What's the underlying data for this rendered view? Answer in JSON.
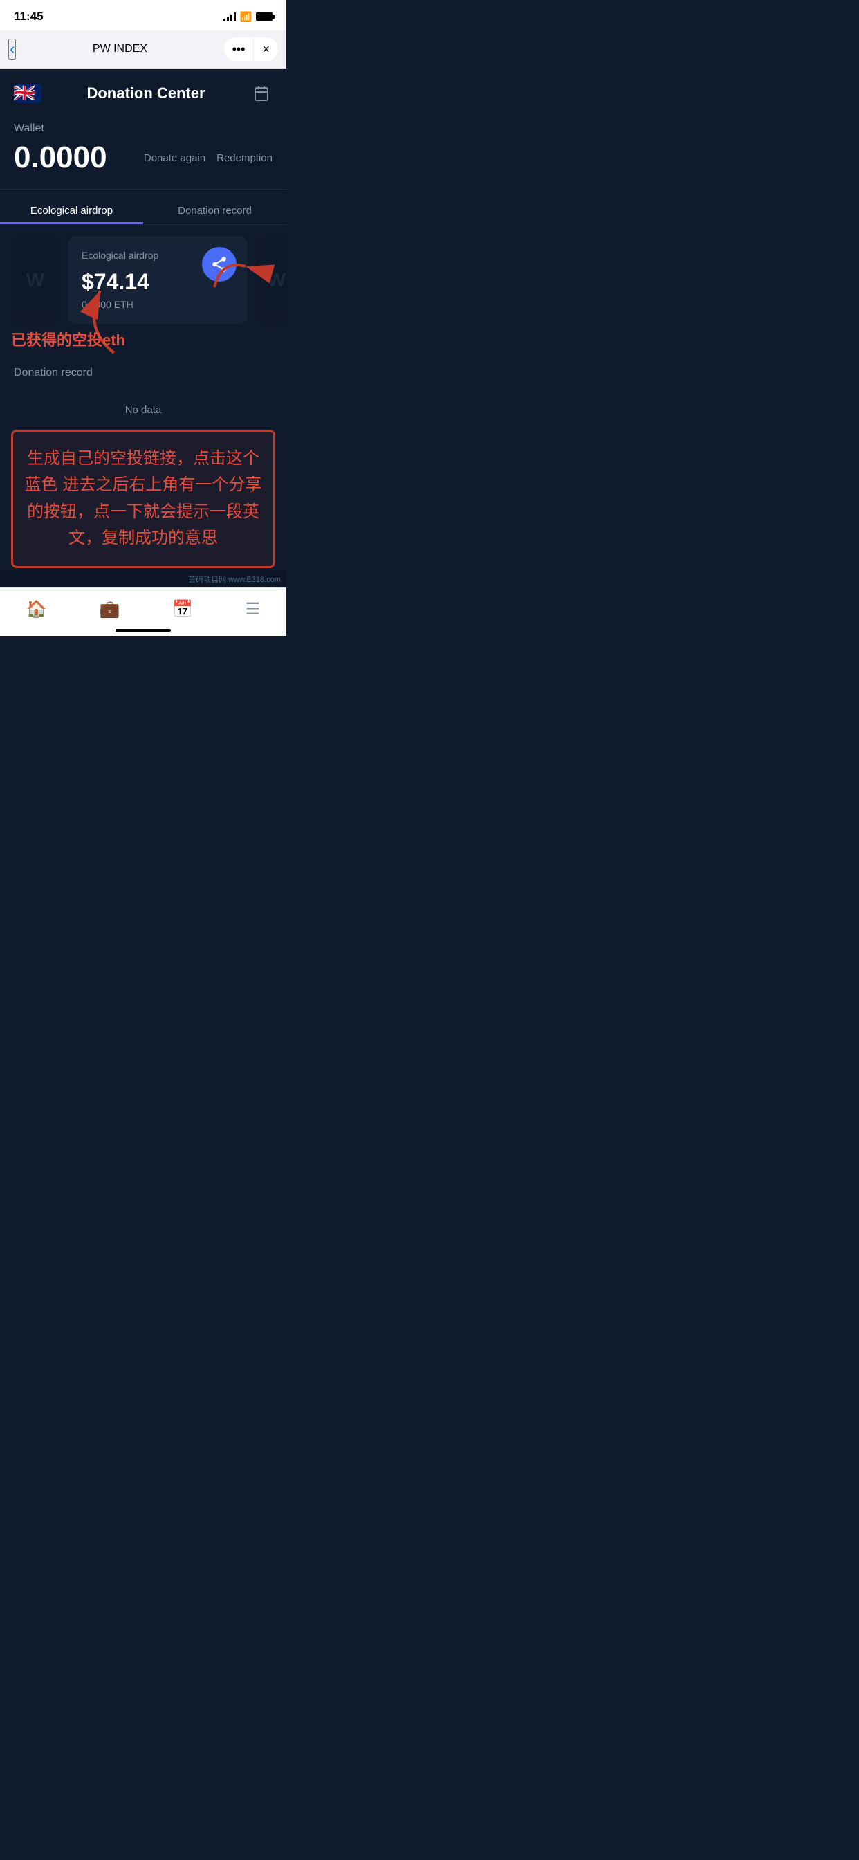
{
  "statusBar": {
    "time": "11:45",
    "batteryFull": true
  },
  "browserBar": {
    "title": "PW INDEX",
    "backLabel": "<",
    "moreLabel": "•••",
    "closeLabel": "×"
  },
  "appHeader": {
    "title": "Donation Center",
    "calendarIcon": "📅"
  },
  "wallet": {
    "label": "Wallet",
    "amount": "0.0000",
    "donateAgainLabel": "Donate again",
    "redemptionLabel": "Redemption"
  },
  "tabs": [
    {
      "label": "Ecological airdrop",
      "active": true
    },
    {
      "label": "Donation record",
      "active": false
    }
  ],
  "airdropCard": {
    "label": "Ecological airdrop",
    "usd": "$74.14",
    "eth": "0.3000 ETH",
    "shareIconLabel": "share-network-icon"
  },
  "donationRecord": {
    "title": "Donation record",
    "noDataLabel": "No data"
  },
  "annotation": {
    "cnLabel": "已获得的空投eth",
    "text": "生成自己的空投链接，点击这个蓝色 进去之后右上角有一个分享的按钮，点一下就会提示一段英文，复制成功的意思"
  },
  "bottomNav": {
    "items": [
      {
        "icon": "🏠",
        "label": "home"
      },
      {
        "icon": "💼",
        "label": "briefcase"
      },
      {
        "icon": "📅",
        "label": "calendar"
      },
      {
        "icon": "☰",
        "label": "menu"
      }
    ]
  },
  "watermark": {
    "text": "首码项目网 www.E318.com"
  }
}
